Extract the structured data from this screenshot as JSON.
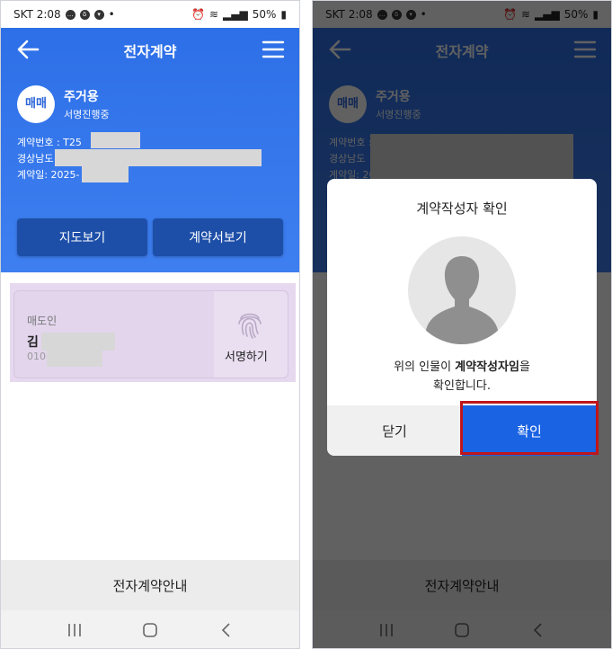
{
  "status_bar": {
    "carrier_time": "SKT 2:08",
    "battery": "50%"
  },
  "header": {
    "title": "전자계약",
    "badge": "매매",
    "use_type": "주거용",
    "status": "서명진행중",
    "contract_no": "계약번호 : T25",
    "address": "경상남도",
    "contract_date": "계약일: 2025-",
    "map_button": "지도보기",
    "contract_button": "계약서보기"
  },
  "signer": {
    "role": "매도인",
    "name": "김",
    "phone": "010-",
    "sign_button": "서명하기"
  },
  "footer": {
    "guide": "전자계약안내"
  },
  "dialog": {
    "title": "계약작성자 확인",
    "message_prefix": "위의 인물이 ",
    "message_bold": "계약작성자임",
    "message_suffix": "을",
    "message_line2": "확인합니다.",
    "close_button": "닫기",
    "confirm_button": "확인"
  },
  "colors": {
    "header_blue": "#3a7aee",
    "button_navy": "#1d4fa8",
    "confirm_blue": "#1a63e3",
    "highlight_red": "#c0151b",
    "signer_card": "#e2d5ec"
  },
  "icons": [
    "back-arrow-icon",
    "hamburger-menu-icon",
    "fingerprint-icon",
    "recents-icon",
    "home-icon",
    "back-icon",
    "person-silhouette-icon"
  ]
}
